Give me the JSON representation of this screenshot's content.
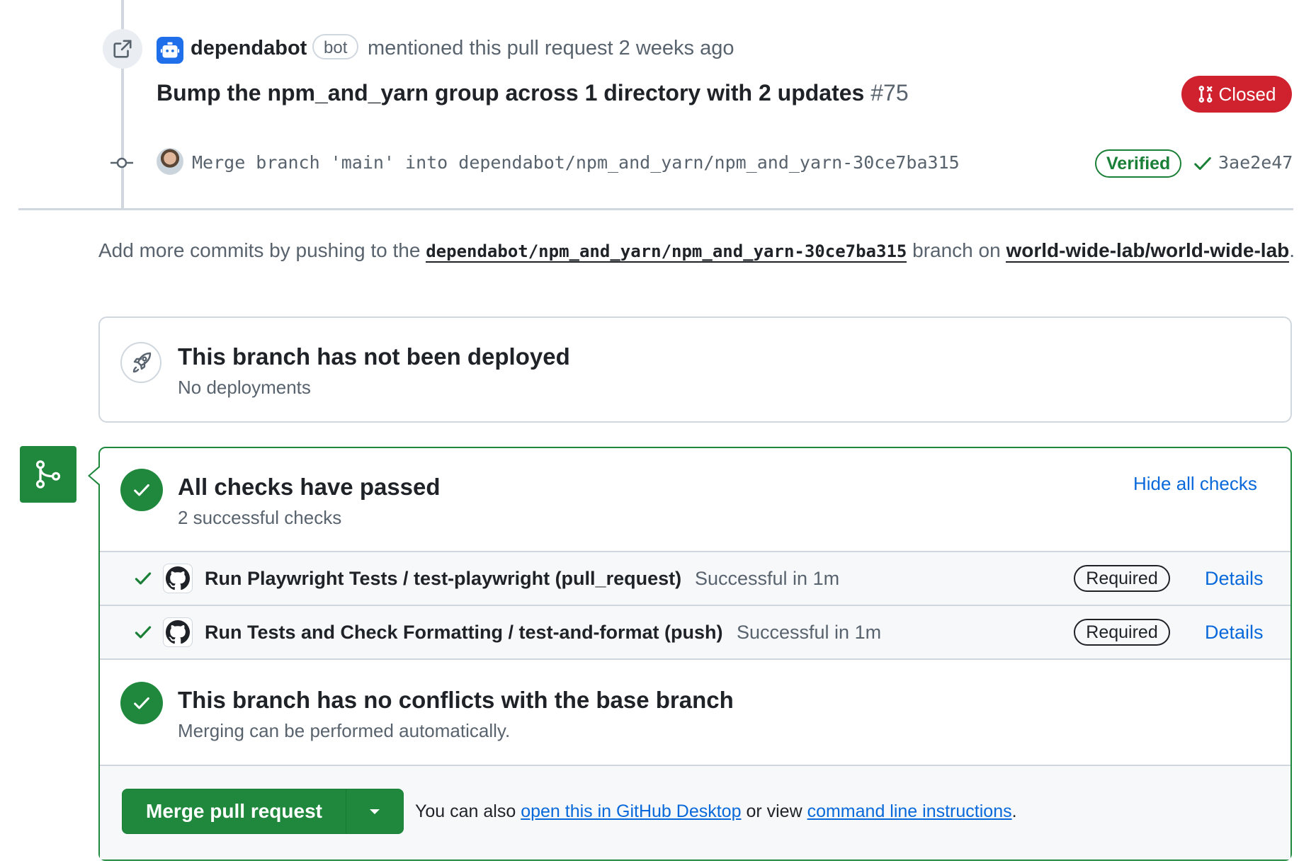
{
  "mention": {
    "author": "dependabot",
    "bot_label": "bot",
    "action": "mentioned this pull request 2 weeks ago",
    "pr_title": "Bump the npm_and_yarn group across 1 directory with 2 updates",
    "pr_number": "#75",
    "pr_state": "Closed"
  },
  "commit": {
    "message": "Merge branch 'main' into dependabot/npm_and_yarn/npm_and_yarn-30ce7ba315",
    "verified_label": "Verified",
    "sha": "3ae2e47"
  },
  "hint": {
    "prefix": "Add more commits by pushing to the",
    "branch": "dependabot/npm_and_yarn/npm_and_yarn-30ce7ba315",
    "middle": "branch on",
    "repo": "world-wide-lab/world-wide-lab",
    "suffix": "."
  },
  "deploy": {
    "title": "This branch has not been deployed",
    "subtitle": "No deployments"
  },
  "checks": {
    "title": "All checks have passed",
    "subtitle": "2 successful checks",
    "hide_label": "Hide all checks",
    "items": [
      {
        "name": "Run Playwright Tests / test-playwright (pull_request)",
        "status": "Successful in 1m",
        "badge": "Required",
        "link": "Details"
      },
      {
        "name": "Run Tests and Check Formatting / test-and-format (push)",
        "status": "Successful in 1m",
        "badge": "Required",
        "link": "Details"
      }
    ]
  },
  "conflicts": {
    "title": "This branch has no conflicts with the base branch",
    "subtitle": "Merging can be performed automatically."
  },
  "merge": {
    "button_label": "Merge pull request",
    "footer_prefix": "You can also",
    "desktop_link": "open this in GitHub Desktop",
    "footer_middle": "or view",
    "cli_link": "command line instructions",
    "footer_suffix": "."
  },
  "colors": {
    "success": "#1f883d",
    "danger": "#cf222e",
    "link": "#0969da",
    "muted": "#59636e",
    "border": "#d0d7de"
  }
}
